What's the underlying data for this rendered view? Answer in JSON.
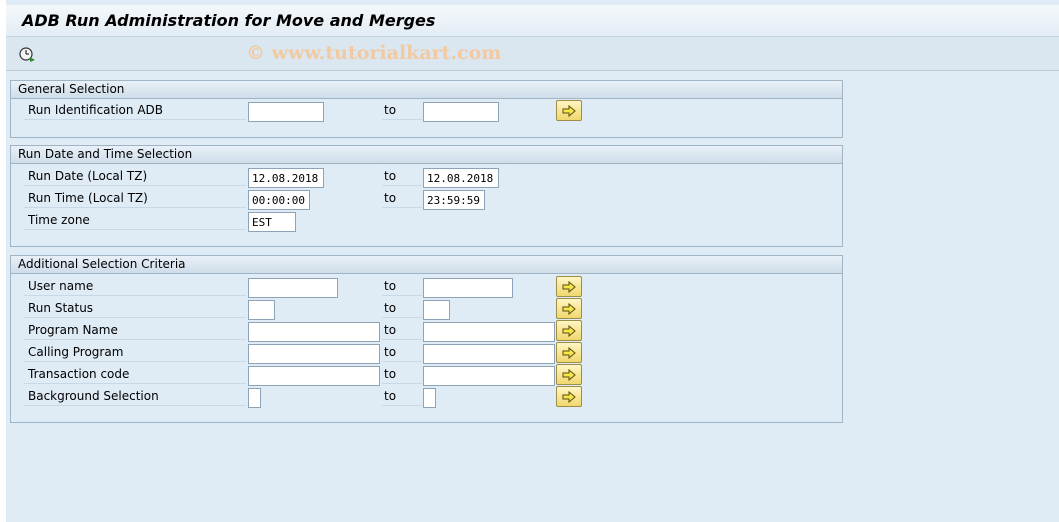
{
  "window": {
    "title": "ADB Run Administration for Move and Merges"
  },
  "toolbar": {
    "execute_icon": "clock-execute-icon",
    "watermark": "© www.tutorialkart.com"
  },
  "colors": {
    "background": "#dfebf5",
    "group_border": "#9fb4c5",
    "button_yellow": "#f0d76d"
  },
  "general_selection": {
    "header": "General Selection",
    "run_id": {
      "label": "Run Identification ADB",
      "from": "",
      "to_label": "to",
      "to": ""
    }
  },
  "date_time_selection": {
    "header": "Run Date and Time Selection",
    "run_date": {
      "label": "Run Date (Local TZ)",
      "from": "12.08.2018",
      "to_label": "to",
      "to": "12.08.2018"
    },
    "run_time": {
      "label": "Run Time (Local TZ)",
      "from": "00:00:00",
      "to_label": "to",
      "to": "23:59:59"
    },
    "time_zone": {
      "label": "Time zone",
      "value": "EST"
    }
  },
  "additional_criteria": {
    "header": "Additional Selection Criteria",
    "user_name": {
      "label": "User name",
      "from": "",
      "to_label": "to",
      "to": ""
    },
    "run_status": {
      "label": "Run Status",
      "from": "",
      "to_label": "to",
      "to": ""
    },
    "program_name": {
      "label": "Program Name",
      "from": "",
      "to_label": "to",
      "to": ""
    },
    "calling_program": {
      "label": "Calling Program",
      "from": "",
      "to_label": "to",
      "to": ""
    },
    "transaction_code": {
      "label": "Transaction code",
      "from": "",
      "to_label": "to",
      "to": ""
    },
    "background_selection": {
      "label": "Background Selection",
      "from": "",
      "to_label": "to",
      "to": ""
    }
  }
}
